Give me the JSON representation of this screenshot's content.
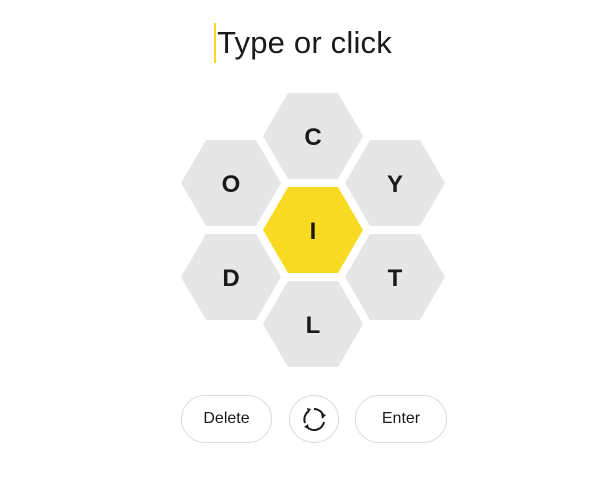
{
  "input": {
    "placeholder": "Type or click"
  },
  "hive": {
    "center_letter": "I",
    "outer_letters": [
      "C",
      "Y",
      "T",
      "L",
      "D",
      "O"
    ],
    "center_color": "#f7da21",
    "outer_color": "#e6e6e6"
  },
  "controls": {
    "delete_label": "Delete",
    "shuffle_icon": "shuffle-icon",
    "enter_label": "Enter"
  }
}
